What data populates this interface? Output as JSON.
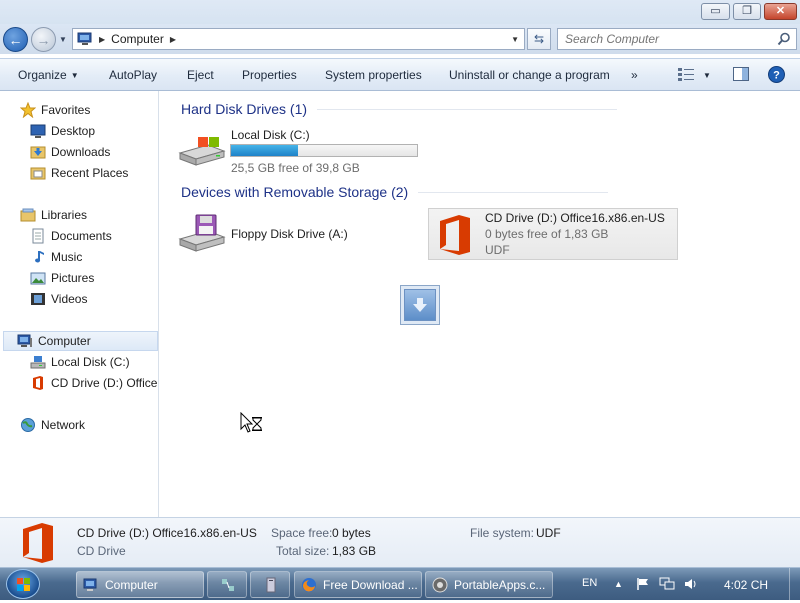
{
  "window": {
    "controls": {
      "minimize": "▭",
      "maximize": "❐",
      "close": "✕"
    }
  },
  "address": {
    "crumb": "Computer",
    "search_placeholder": "Search Computer"
  },
  "toolbar": {
    "organize": "Organize",
    "autoplay": "AutoPlay",
    "eject": "Eject",
    "properties": "Properties",
    "system_properties": "System properties",
    "uninstall": "Uninstall or change a program",
    "more": "»"
  },
  "nav": {
    "favorites": "Favorites",
    "desktop": "Desktop",
    "downloads": "Downloads",
    "recent_places": "Recent Places",
    "libraries": "Libraries",
    "documents": "Documents",
    "music": "Music",
    "pictures": "Pictures",
    "videos": "Videos",
    "computer": "Computer",
    "local_disk": "Local Disk (C:)",
    "cd_drive": "CD Drive (D:) Office16.x86.en-US",
    "network": "Network"
  },
  "content": {
    "hdd_header": "Hard Disk Drives (1)",
    "removable_header": "Devices with Removable Storage (2)",
    "local_disk": {
      "name": "Local Disk (C:)",
      "free": "25,5 GB free of 39,8 GB",
      "used_fraction": 0.36
    },
    "floppy": {
      "name": "Floppy Disk Drive (A:)"
    },
    "cd": {
      "name": "CD Drive (D:) Office16.x86.en-US",
      "free": "0 bytes free of 1,83 GB",
      "fs": "UDF"
    }
  },
  "details": {
    "name": "CD Drive (D:) Office16.x86.en-US",
    "type": "CD Drive",
    "space_free_label": "Space free:",
    "space_free_value": "0 bytes",
    "total_size_label": "Total size:",
    "total_size_value": "1,83 GB",
    "fs_label": "File system:",
    "fs_value": "UDF"
  },
  "taskbar": {
    "computer": "Computer",
    "firefox": "Free Download ...",
    "portableapps": "PortableApps.c...",
    "lang": "EN",
    "time": "4:02 CH"
  },
  "colors": {
    "group_header": "#1e3287",
    "capacity_fill": "#1e82c8",
    "office_red": "#d83b01"
  }
}
